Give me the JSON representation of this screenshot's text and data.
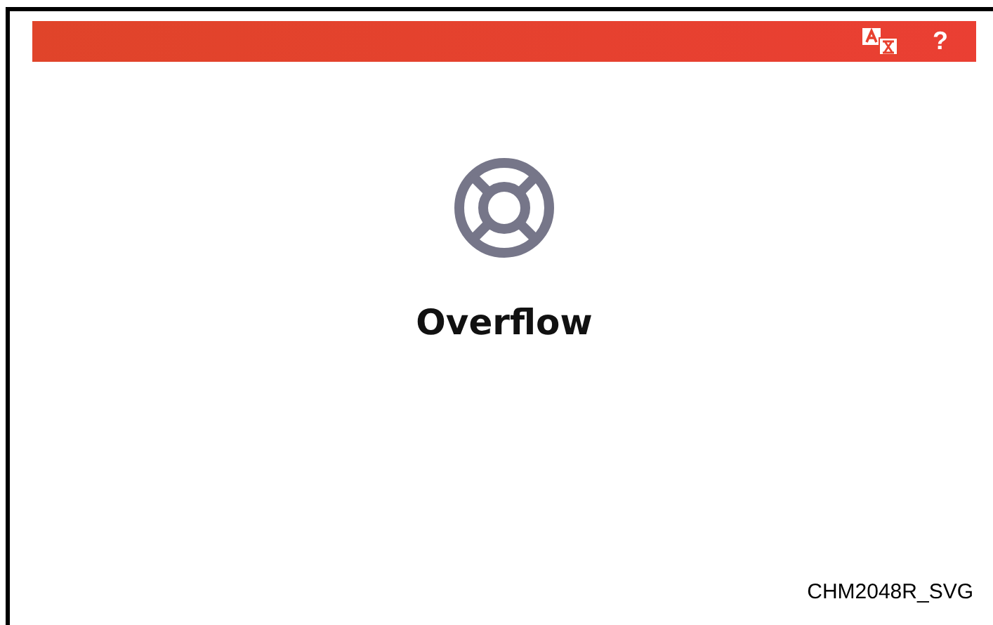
{
  "header": {
    "help_label": "?"
  },
  "content": {
    "title": "Overflow"
  },
  "footer": {
    "figure_id": "CHM2048R_SVG"
  }
}
